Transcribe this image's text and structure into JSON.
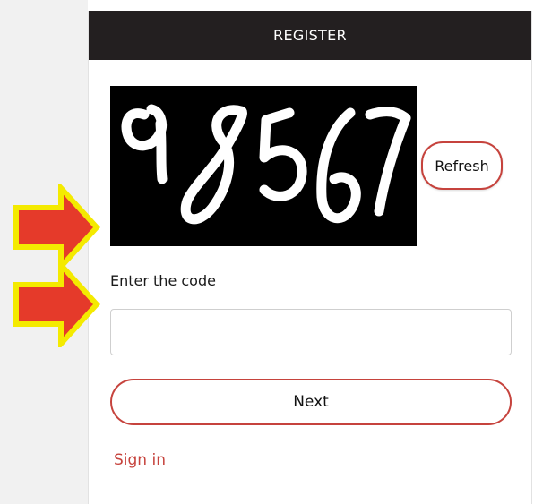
{
  "header": {
    "title": "REGISTER"
  },
  "captcha": {
    "code": "98567"
  },
  "refresh_button": {
    "label": "Refresh"
  },
  "code_field": {
    "label": "Enter the code",
    "value": "",
    "placeholder": ""
  },
  "next_button": {
    "label": "Next"
  },
  "sign_in_link": {
    "label": "Sign in"
  },
  "colors": {
    "header_bg": "#231f20",
    "accent": "#c6433d",
    "arrow_fill": "#e53a2a",
    "arrow_outline": "#f4ea00"
  }
}
